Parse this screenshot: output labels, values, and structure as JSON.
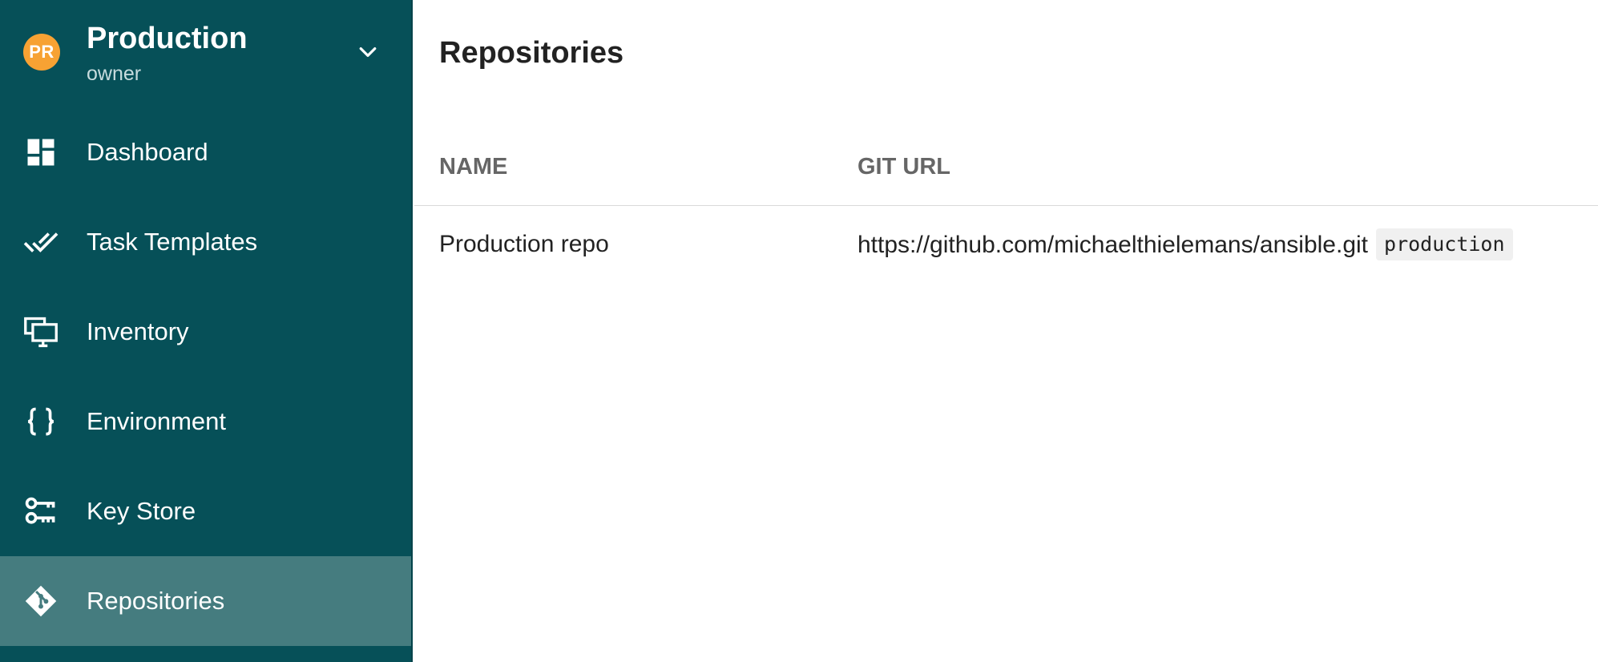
{
  "project": {
    "avatar_initials": "PR",
    "avatar_color": "#f7a233",
    "name": "Production",
    "role": "owner",
    "dropdown_icon": "chevron-down-icon"
  },
  "sidebar": {
    "background": "#065058",
    "active_background": "#457c7f",
    "items": [
      {
        "label": "Dashboard",
        "icon": "dashboard-icon",
        "active": false
      },
      {
        "label": "Task Templates",
        "icon": "double-check-icon",
        "active": false
      },
      {
        "label": "Inventory",
        "icon": "monitor-icon",
        "active": false
      },
      {
        "label": "Environment",
        "icon": "curly-braces-icon",
        "active": false
      },
      {
        "label": "Key Store",
        "icon": "keys-icon",
        "active": false
      },
      {
        "label": "Repositories",
        "icon": "git-icon",
        "active": true
      }
    ]
  },
  "main": {
    "title": "Repositories",
    "table": {
      "columns": [
        "NAME",
        "GIT URL"
      ],
      "rows": [
        {
          "name": "Production repo",
          "git_url": "https://github.com/michaelthielemans/ansible.git",
          "branch": "production"
        }
      ]
    }
  }
}
